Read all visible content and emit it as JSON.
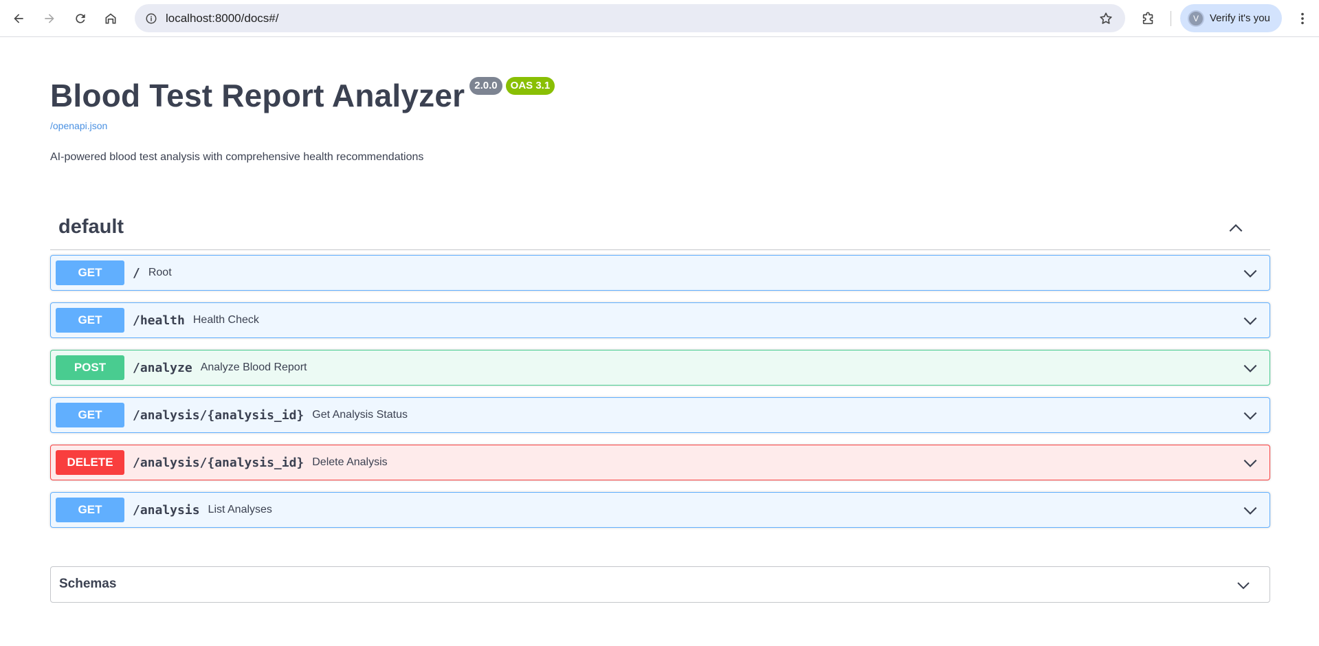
{
  "browser": {
    "url": "localhost:8000/docs#/",
    "profile_label": "Verify it's you",
    "profile_initial": "V"
  },
  "api": {
    "title": "Blood Test Report Analyzer",
    "version": "2.0.0",
    "oas": "OAS 3.1",
    "spec_link": "/openapi.json",
    "description": "AI-powered blood test analysis with comprehensive health recommendations"
  },
  "tag": {
    "name": "default"
  },
  "operations": [
    {
      "method": "GET",
      "path": "/",
      "summary": "Root"
    },
    {
      "method": "GET",
      "path": "/health",
      "summary": "Health Check"
    },
    {
      "method": "POST",
      "path": "/analyze",
      "summary": "Analyze Blood Report"
    },
    {
      "method": "GET",
      "path": "/analysis/{analysis_id}",
      "summary": "Get Analysis Status"
    },
    {
      "method": "DELETE",
      "path": "/analysis/{analysis_id}",
      "summary": "Delete Analysis"
    },
    {
      "method": "GET",
      "path": "/analysis",
      "summary": "List Analyses"
    }
  ],
  "schemas": {
    "label": "Schemas"
  },
  "colors": {
    "get": "#61affe",
    "post": "#49cc90",
    "delete": "#f93e3e",
    "version_badge": "#7d8492",
    "oas_badge": "#89bf04",
    "link": "#4990e2"
  },
  "icons": {
    "back": "arrow-left-icon",
    "forward": "arrow-right-icon",
    "reload": "reload-icon",
    "home": "home-icon",
    "site_info": "info-icon",
    "bookmark": "star-icon",
    "extensions": "puzzle-icon",
    "menu": "more-vertical-icon",
    "collapse": "chevron-up-icon",
    "expand": "chevron-down-icon"
  }
}
